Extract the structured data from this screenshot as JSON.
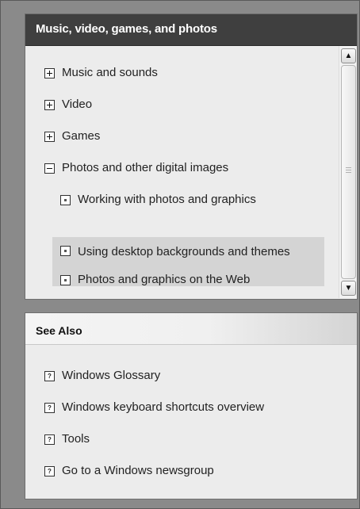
{
  "top_panel": {
    "header": "Music, video, games, and photos",
    "items": [
      {
        "label": "Music and sounds",
        "state": "collapsed"
      },
      {
        "label": "Video",
        "state": "collapsed"
      },
      {
        "label": "Games",
        "state": "collapsed"
      },
      {
        "label": "Photos and other digital images",
        "state": "expanded"
      },
      {
        "label": "Working with photos and graphics",
        "state": "leaf"
      },
      {
        "label": "Using desktop backgrounds and themes",
        "state": "leaf",
        "selected": true
      },
      {
        "label": "Photos and graphics on the Web",
        "state": "leaf"
      }
    ],
    "scroll_up_icon": "chevron-up-icon",
    "scroll_down_icon": "chevron-down-icon"
  },
  "bottom_panel": {
    "header": "See Also",
    "links": [
      {
        "label": "Windows Glossary"
      },
      {
        "label": "Windows keyboard shortcuts overview"
      },
      {
        "label": "Tools"
      },
      {
        "label": "Go to a Windows newsgroup"
      }
    ],
    "link_icon": "help-topic-icon",
    "link_icon_glyph": "?"
  },
  "colors": {
    "frame_bg": "#8a8a8a",
    "panel_bg": "#ececec",
    "dark_header_bg": "#3f3f3f",
    "selected_bg": "#d4d4d4"
  }
}
